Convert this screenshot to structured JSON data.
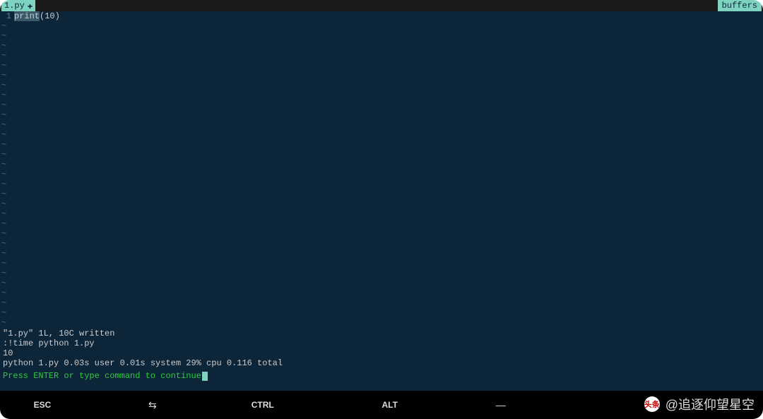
{
  "tab": {
    "filename": "1.py",
    "modified_indicator": "✚"
  },
  "buffers_label": "buffers",
  "editor": {
    "line_number": "1",
    "code_keyword": "print",
    "code_args": "(10)",
    "tilde": "~",
    "tilde_count": 31
  },
  "output": {
    "line1": "\"1.py\" 1L, 10C written",
    "line2": ":!time python 1.py",
    "line3": "10",
    "line4": "python 1.py  0.03s user 0.01s system 29% cpu 0.116 total"
  },
  "prompt": "Press ENTER or type command to continue",
  "bottom_keys": {
    "esc": "ESC",
    "tab_symbol": "⇆",
    "ctrl": "CTRL",
    "alt": "ALT",
    "dash": "—"
  },
  "watermark": {
    "icon_text": "头条",
    "text": "@追逐仰望星空"
  }
}
